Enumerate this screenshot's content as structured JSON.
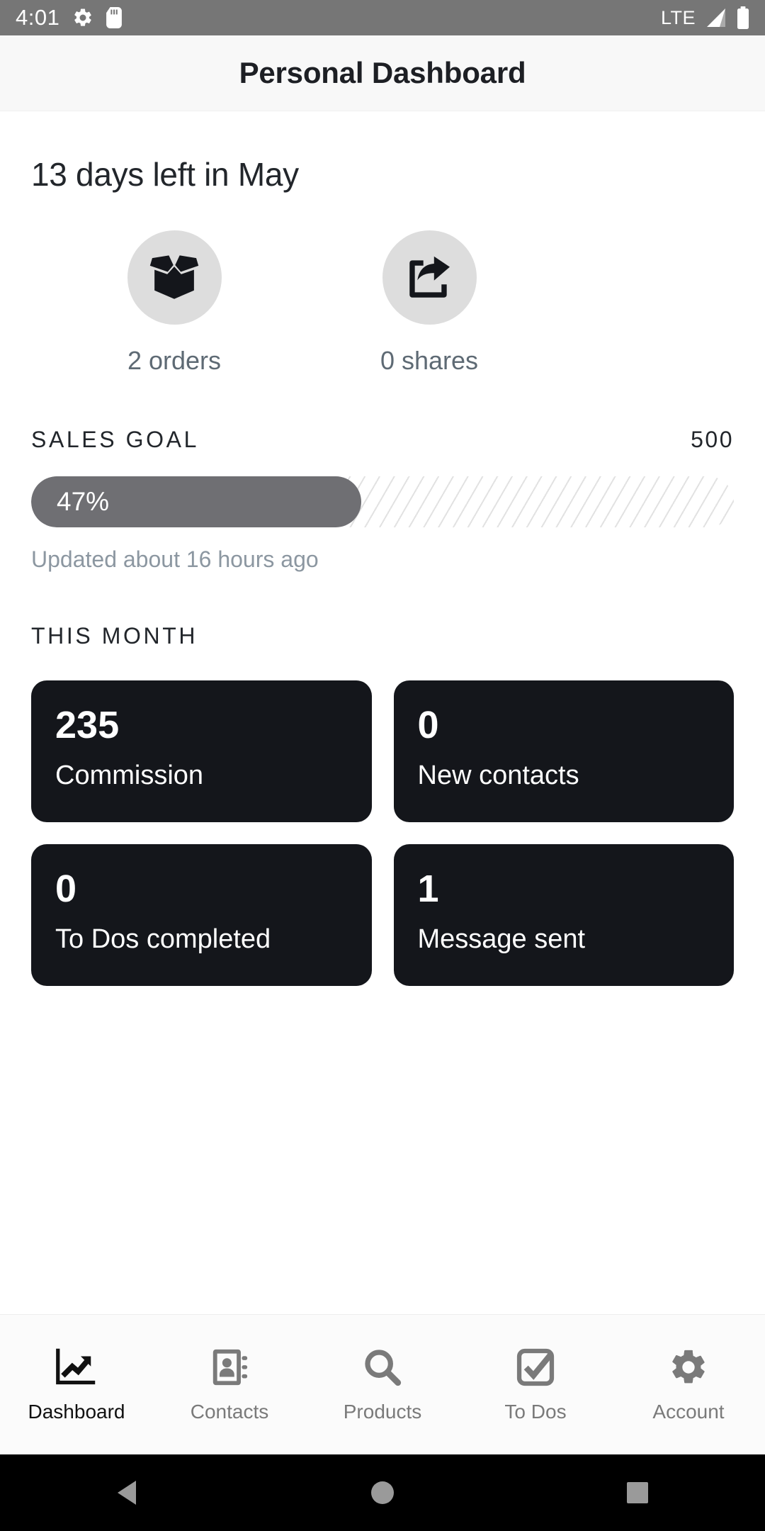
{
  "status_bar": {
    "time": "4:01",
    "network": "LTE",
    "icons": [
      "gear-icon",
      "sd-card-icon",
      "signal-icon",
      "battery-icon"
    ]
  },
  "header": {
    "title": "Personal Dashboard"
  },
  "main": {
    "days_left": "13 days left in May",
    "quick_stats": [
      {
        "icon": "open-box-icon",
        "label": "2 orders"
      },
      {
        "icon": "share-icon",
        "label": "0 shares"
      }
    ],
    "sales_goal": {
      "title": "SALES GOAL",
      "target": "500",
      "progress_label": "47%",
      "progress_percent": 47,
      "updated": "Updated about 16 hours ago"
    },
    "this_month": {
      "title": "THIS MONTH",
      "cards": [
        {
          "value": "235",
          "caption": "Commission"
        },
        {
          "value": "0",
          "caption": "New contacts"
        },
        {
          "value": "0",
          "caption": "To Dos completed"
        },
        {
          "value": "1",
          "caption": "Message sent"
        }
      ]
    }
  },
  "bottom_nav": {
    "items": [
      {
        "label": "Dashboard",
        "icon": "chart-arrow-icon",
        "active": true
      },
      {
        "label": "Contacts",
        "icon": "address-book-icon",
        "active": false
      },
      {
        "label": "Products",
        "icon": "search-icon",
        "active": false
      },
      {
        "label": "To Dos",
        "icon": "checkbox-check-icon",
        "active": false
      },
      {
        "label": "Account",
        "icon": "gear-icon",
        "active": false
      }
    ]
  },
  "android_nav": {
    "buttons": [
      "back-triangle-icon",
      "home-circle-icon",
      "recents-square-icon"
    ]
  },
  "colors": {
    "status_bar_bg": "#767676",
    "header_bg": "#f8f8f8",
    "card_bg": "#14161b",
    "progress_fill": "#6f6f73",
    "circle_bg": "#dddddd",
    "muted_text": "#5e6a74"
  }
}
